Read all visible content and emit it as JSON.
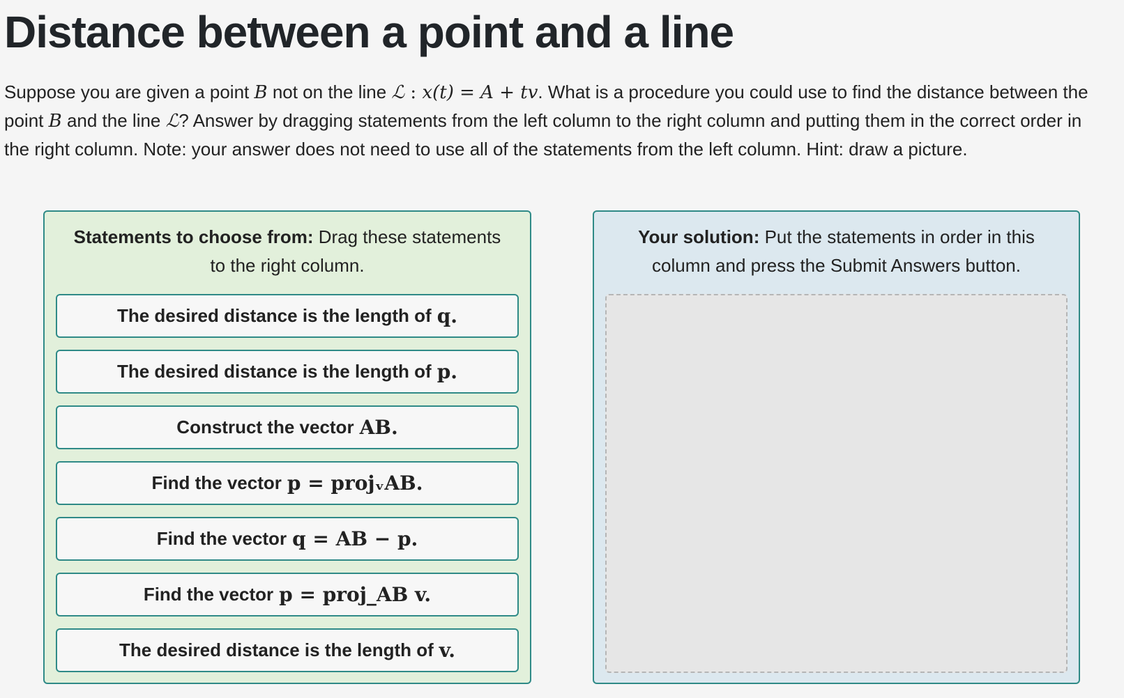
{
  "title": "Distance between a point and a line",
  "prompt": {
    "t1": "Suppose you are given a point ",
    "B": "B",
    "t2": " not on the line ",
    "L": "ℒ",
    "colon": " : ",
    "xt": "x(t) = A + tv",
    "t3": ". What is a procedure you could use to find the distance between the point ",
    "t4": " and the line ",
    "t5": "? Answer by dragging statements from the left column to the right column and putting them in the correct order in the right column. Note: your answer does not need to use all of the statements from the left column. Hint: draw a picture."
  },
  "left_column": {
    "header_bold": "Statements to choose from:",
    "header_text": " Drag these statements to the right column.",
    "items": [
      {
        "text": "The desired distance is the length of",
        "math": "q."
      },
      {
        "text": "The desired distance is the length of",
        "math": "p."
      },
      {
        "text": "Construct the vector",
        "math": "AB."
      },
      {
        "text": "Find the vector",
        "math": "p = projᵥAB."
      },
      {
        "text": "Find the vector",
        "math": "q = AB − p."
      },
      {
        "text": "Find the vector",
        "math": "p = proj_AB v."
      },
      {
        "text": "The desired distance is the length of",
        "math": "v."
      }
    ]
  },
  "right_column": {
    "header_bold": "Your solution:",
    "header_text": " Put the statements in order in this column and press the Submit Answers button."
  },
  "colors": {
    "left_bg": "#e2f0db",
    "right_bg": "#dce8ef",
    "border": "#2f8a87",
    "dropzone_bg": "#e6e6e6"
  }
}
